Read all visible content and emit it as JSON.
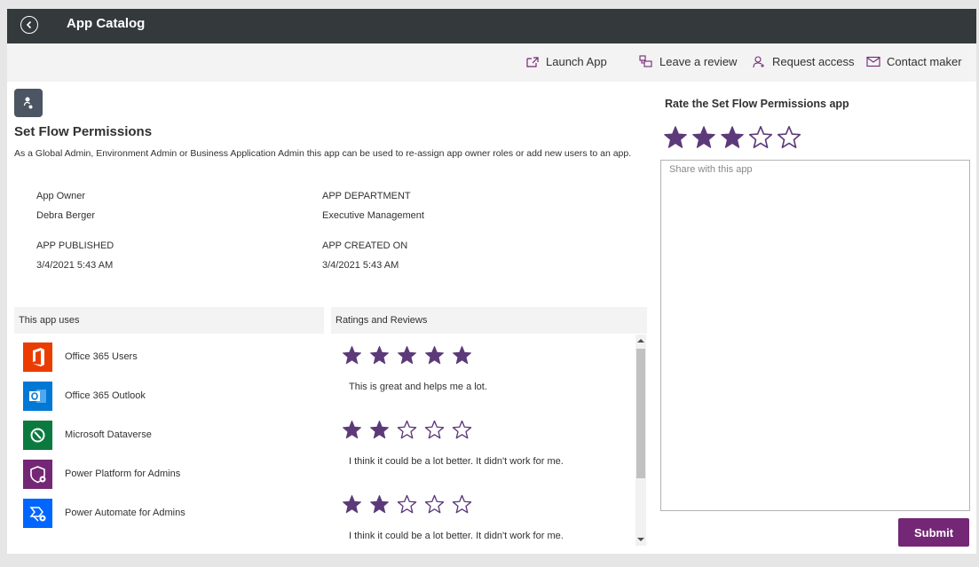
{
  "topbar": {
    "title": "App Catalog"
  },
  "commands": {
    "launch": "Launch App",
    "review": "Leave a review",
    "request": "Request access",
    "contact": "Contact maker"
  },
  "app": {
    "name": "Set Flow Permissions",
    "description": "As a Global Admin, Environment Admin or Business Application Admin this app can be used to re-assign app owner roles or add new users to an app."
  },
  "meta": {
    "owner_label": "App Owner",
    "owner_value": "Debra Berger",
    "department_label": "APP DEPARTMENT",
    "department_value": "Executive Management",
    "published_label": "APP PUBLISHED",
    "published_value": "3/4/2021 5:43 AM",
    "created_label": "APP CREATED ON",
    "created_value": "3/4/2021 5:43 AM"
  },
  "uses": {
    "title": "This app uses",
    "items": [
      {
        "label": "Office 365 Users",
        "icon": "office-365-icon",
        "color": "#eb3c00"
      },
      {
        "label": "Office 365 Outlook",
        "icon": "outlook-icon",
        "color": "#0078d4"
      },
      {
        "label": "Microsoft Dataverse",
        "icon": "dataverse-icon",
        "color": "#0b7a3e"
      },
      {
        "label": "Power Platform for Admins",
        "icon": "power-platform-shield-icon",
        "color": "#742774"
      },
      {
        "label": "Power Automate for Admins",
        "icon": "power-automate-icon",
        "color": "#0066ff"
      }
    ]
  },
  "reviews": {
    "title": "Ratings and Reviews",
    "items": [
      {
        "rating": 5,
        "text": "This is great and helps me a lot."
      },
      {
        "rating": 2,
        "text": "I think it could be a lot better. It didn't work for me."
      },
      {
        "rating": 2,
        "text": "I think it could be a lot better. It didn't work for me."
      }
    ]
  },
  "rate": {
    "title": "Rate the Set Flow Permissions app",
    "rating": 3,
    "max": 5,
    "placeholder": "Share with this app",
    "submit": "Submit"
  },
  "colors": {
    "topbar": "#343a3c",
    "accent": "#742774",
    "star": "#5c3a7a"
  }
}
